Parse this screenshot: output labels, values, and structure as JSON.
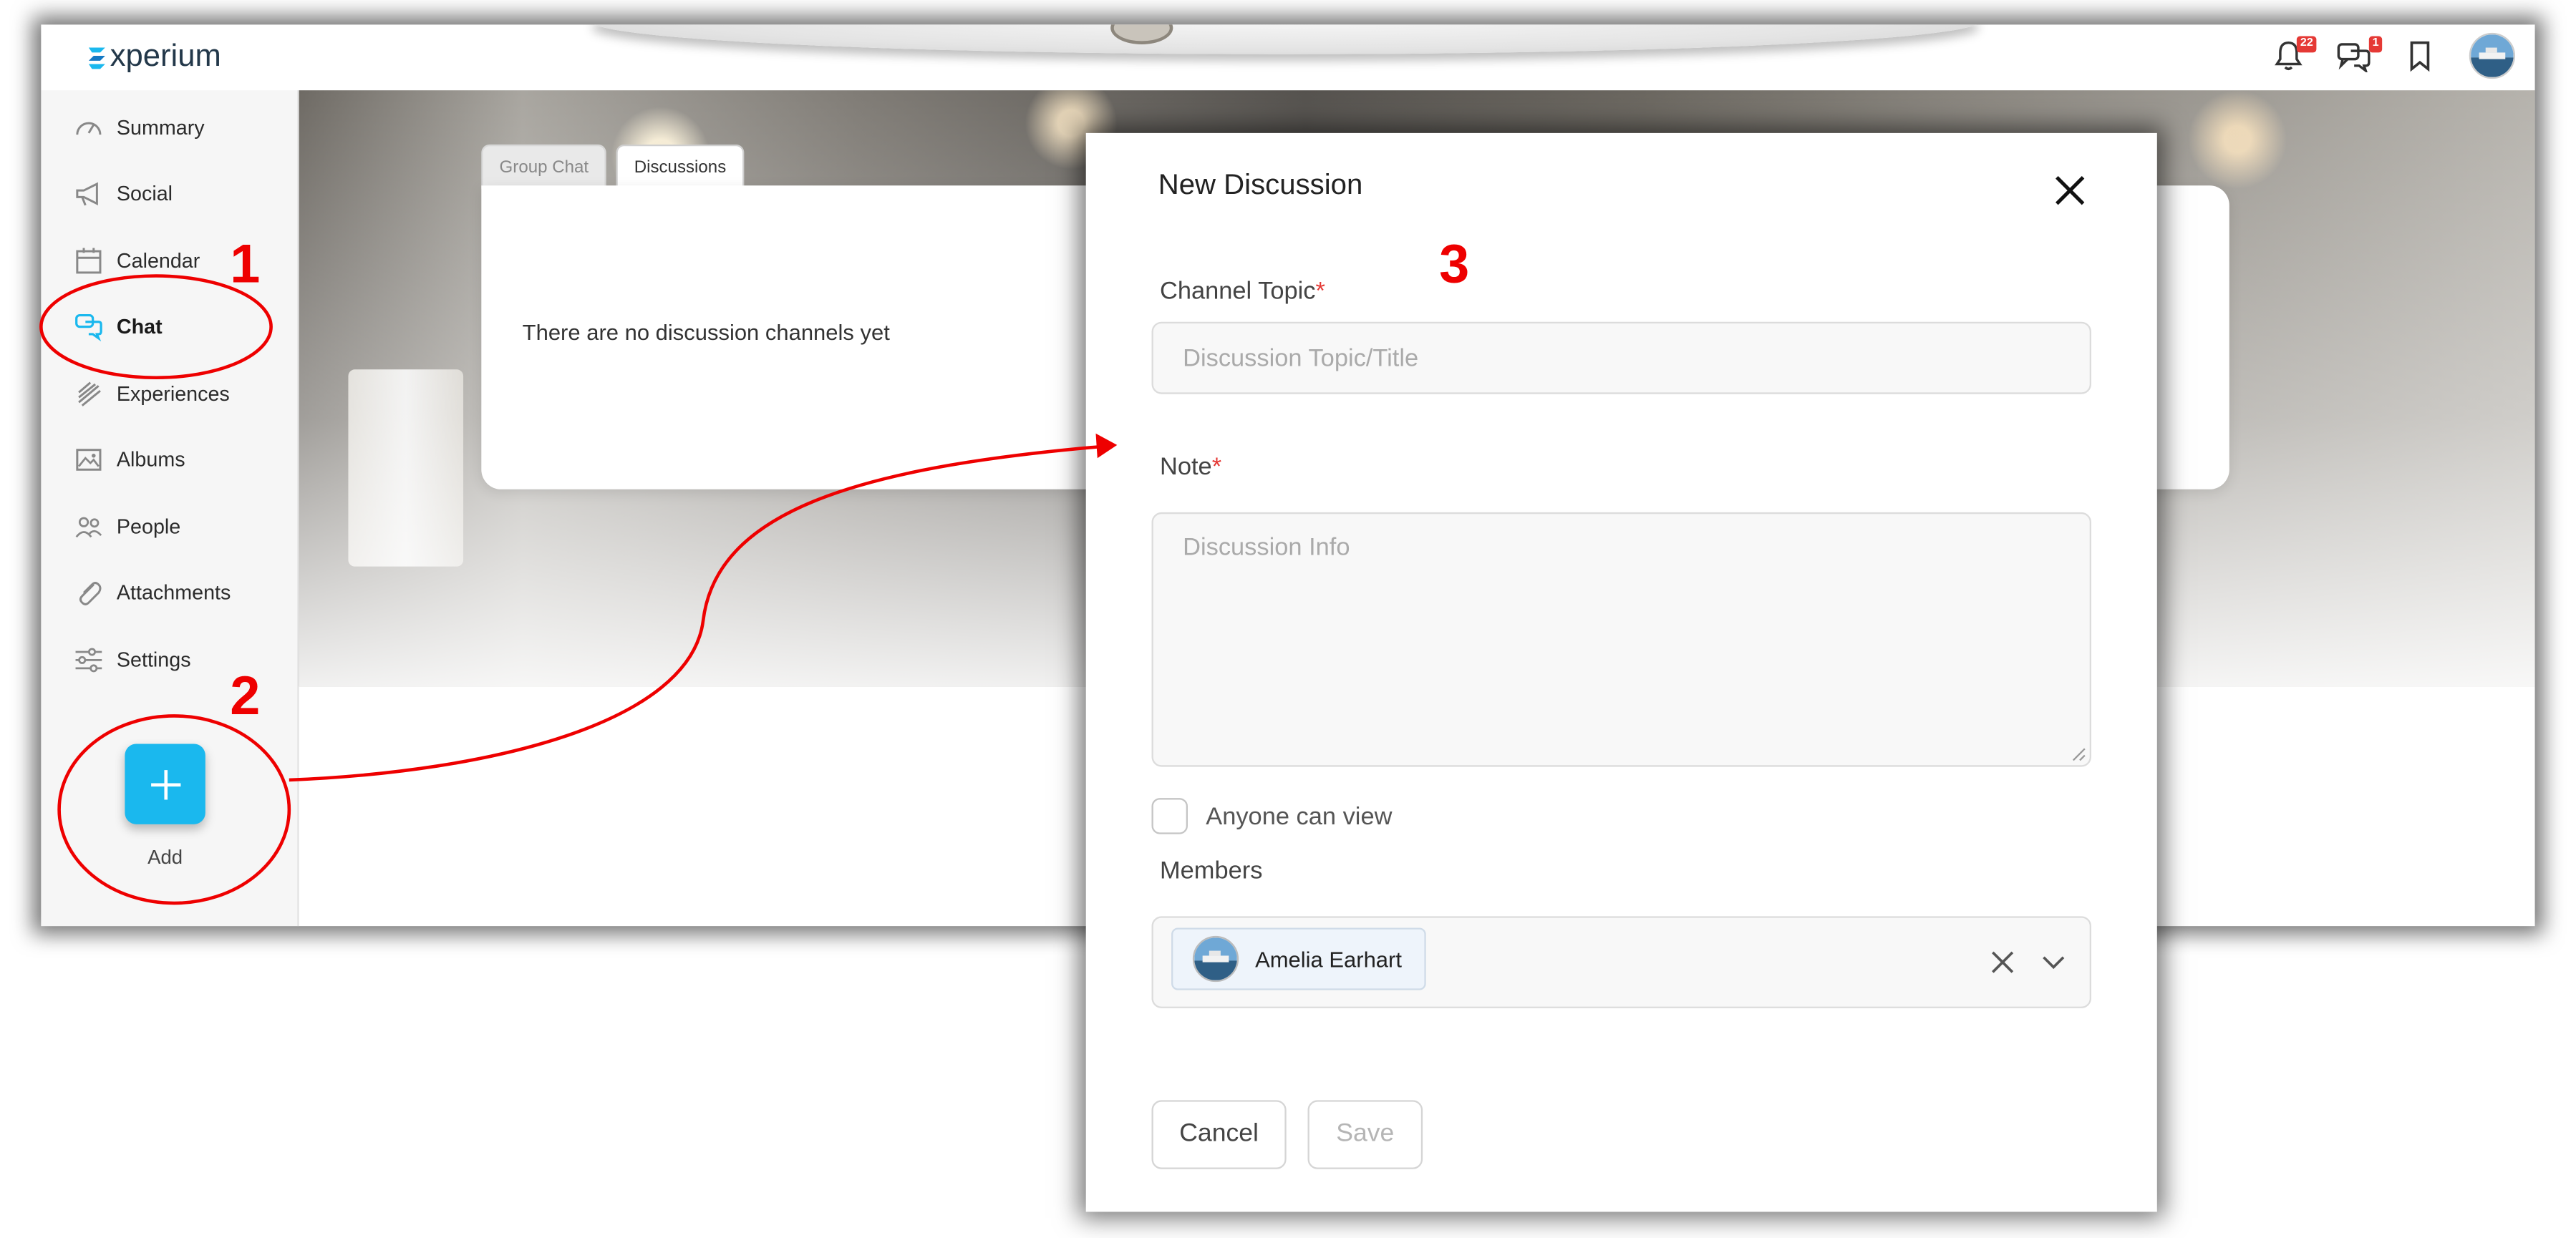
{
  "app": {
    "logo_text": "xperium"
  },
  "topbar": {
    "notifications_count": "22",
    "messages_count": "1"
  },
  "sidebar": {
    "items": [
      {
        "label": "Summary",
        "icon": "gauge-icon"
      },
      {
        "label": "Social",
        "icon": "megaphone-icon"
      },
      {
        "label": "Calendar",
        "icon": "calendar-icon"
      },
      {
        "label": "Chat",
        "icon": "chat-bubbles-icon",
        "active": true
      },
      {
        "label": "Experiences",
        "icon": "layers-icon"
      },
      {
        "label": "Albums",
        "icon": "image-icon"
      },
      {
        "label": "People",
        "icon": "people-icon"
      },
      {
        "label": "Attachments",
        "icon": "paperclip-icon"
      },
      {
        "label": "Settings",
        "icon": "sliders-icon"
      }
    ],
    "add_label": "Add"
  },
  "tabs": {
    "group_chat": "Group Chat",
    "discussions": "Discussions"
  },
  "panel": {
    "empty_message": "There are no discussion channels yet"
  },
  "dialog": {
    "title": "New Discussion",
    "channel_topic_label": "Channel Topic",
    "channel_topic_placeholder": "Discussion Topic/Title",
    "note_label": "Note",
    "note_placeholder": "Discussion Info",
    "required_mark": "*",
    "anyone_can_view_label": "Anyone can view",
    "members_label": "Members",
    "members": [
      {
        "name": "Amelia Earhart"
      }
    ],
    "cancel_label": "Cancel",
    "save_label": "Save"
  },
  "annotations": {
    "step1": "1",
    "step2": "2",
    "step3": "3"
  },
  "colors": {
    "accent": "#1ab8ee",
    "annotation": "#e00000",
    "required": "#e53935"
  }
}
